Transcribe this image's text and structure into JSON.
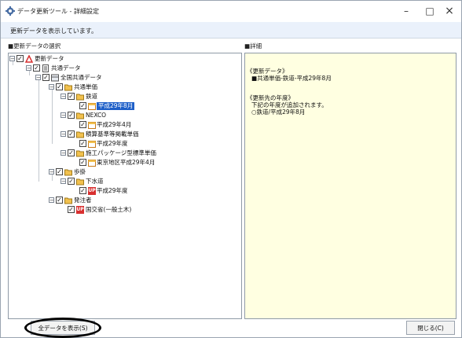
{
  "window": {
    "title": "データ更新ツール - 詳細設定",
    "minimize_glyph": "–",
    "maximize_glyph": "□",
    "close_glyph": "×"
  },
  "status": {
    "text": "更新データを表示しています。"
  },
  "left_header": "■更新データの選択",
  "right_header": "■詳細",
  "tree": {
    "root": "更新データ",
    "common": "共通データ",
    "all_common": "全国共通データ",
    "common_unit": "共通単価",
    "railway": "鉄道",
    "railway_item": "平成29年8月",
    "nexco": "NEXCO",
    "nexco_item": "平成29年4月",
    "sekisan": "積算基準等掲載単価",
    "sekisan_item": "平成29年度",
    "package": "施工パッケージ型標準単価",
    "package_item": "東京地区平成29年4月",
    "hokake": "歩掛",
    "sewer": "下水道",
    "sewer_item": "平成29年度",
    "orderer": "発注者",
    "mlit": "国交省(一般土木)"
  },
  "detail": {
    "line1": "《更新データ》",
    "line2": "■共通単価-鉄道-平成29年8月",
    "line3": "《更新先の年度》",
    "line4": "下記の年度が追加されます。",
    "line5": "○鉄道/平成29年8月"
  },
  "buttons": {
    "show_all": "全データを表示(S)",
    "close": "閉じる(C)"
  },
  "check_mark": "✓",
  "expander_minus": "−",
  "icon_up_text": "UP",
  "colors": {
    "selection": "#1e5fc8",
    "detail_bg": "#ffffe1",
    "folder": "#f2c14e",
    "up_badge": "#d83030"
  }
}
